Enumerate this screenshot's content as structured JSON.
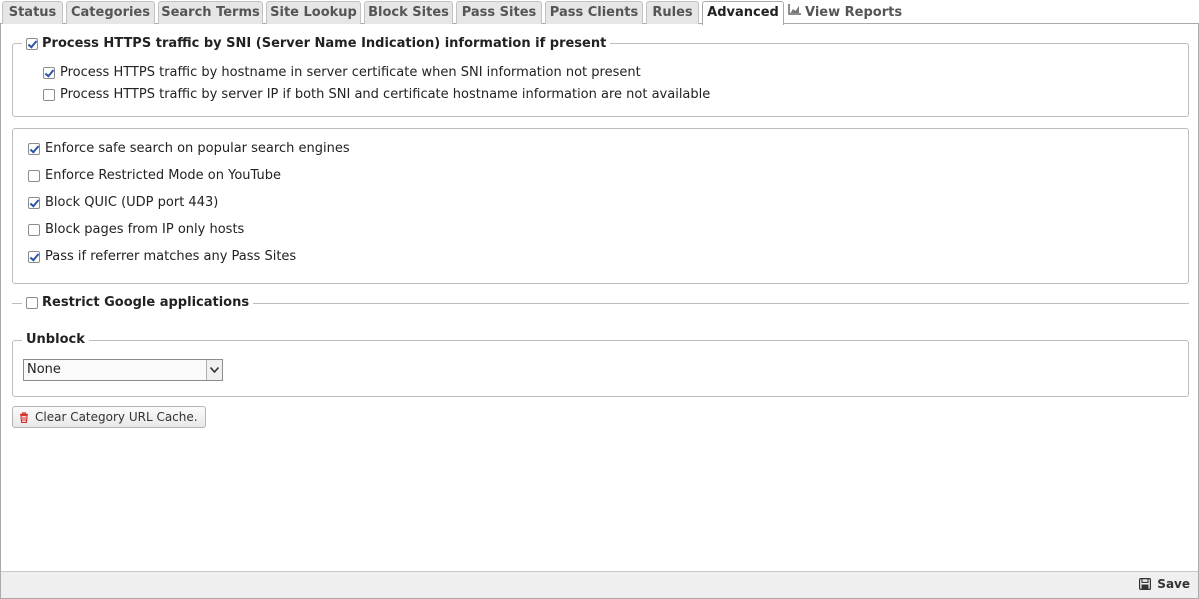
{
  "tabs": [
    {
      "label": "Status"
    },
    {
      "label": "Categories"
    },
    {
      "label": "Search Terms"
    },
    {
      "label": "Site Lookup"
    },
    {
      "label": "Block Sites"
    },
    {
      "label": "Pass Sites"
    },
    {
      "label": "Pass Clients"
    },
    {
      "label": "Rules"
    },
    {
      "label": "Advanced",
      "active": true
    },
    {
      "label": "View Reports",
      "icon": "chart-icon"
    }
  ],
  "https_section": {
    "legend": {
      "label": "Process HTTPS traffic by SNI (Server Name Indication) information if present",
      "checked": true
    },
    "options": [
      {
        "label": "Process HTTPS traffic by hostname in server certificate when SNI information not present",
        "checked": true
      },
      {
        "label": "Process HTTPS traffic by server IP if both SNI and certificate hostname information are not available",
        "checked": false
      }
    ]
  },
  "general_options": [
    {
      "label": "Enforce safe search on popular search engines",
      "checked": true
    },
    {
      "label": "Enforce Restricted Mode on YouTube",
      "checked": false
    },
    {
      "label": "Block QUIC (UDP port 443)",
      "checked": true
    },
    {
      "label": "Block pages from IP only hosts",
      "checked": false
    },
    {
      "label": "Pass if referrer matches any Pass Sites",
      "checked": true
    }
  ],
  "google_section": {
    "label": "Restrict Google applications",
    "checked": false
  },
  "unblock_section": {
    "legend": "Unblock",
    "selected": "None"
  },
  "clear_cache_button": {
    "label": "Clear Category URL Cache.",
    "icon": "trash-icon",
    "icon_color": "#d9312b"
  },
  "save_button": {
    "label": "Save",
    "icon": "floppy-disk-icon"
  },
  "colors": {
    "check": "#2b55a8",
    "border": "#bdbdbd",
    "footer_bg": "#efefef"
  }
}
